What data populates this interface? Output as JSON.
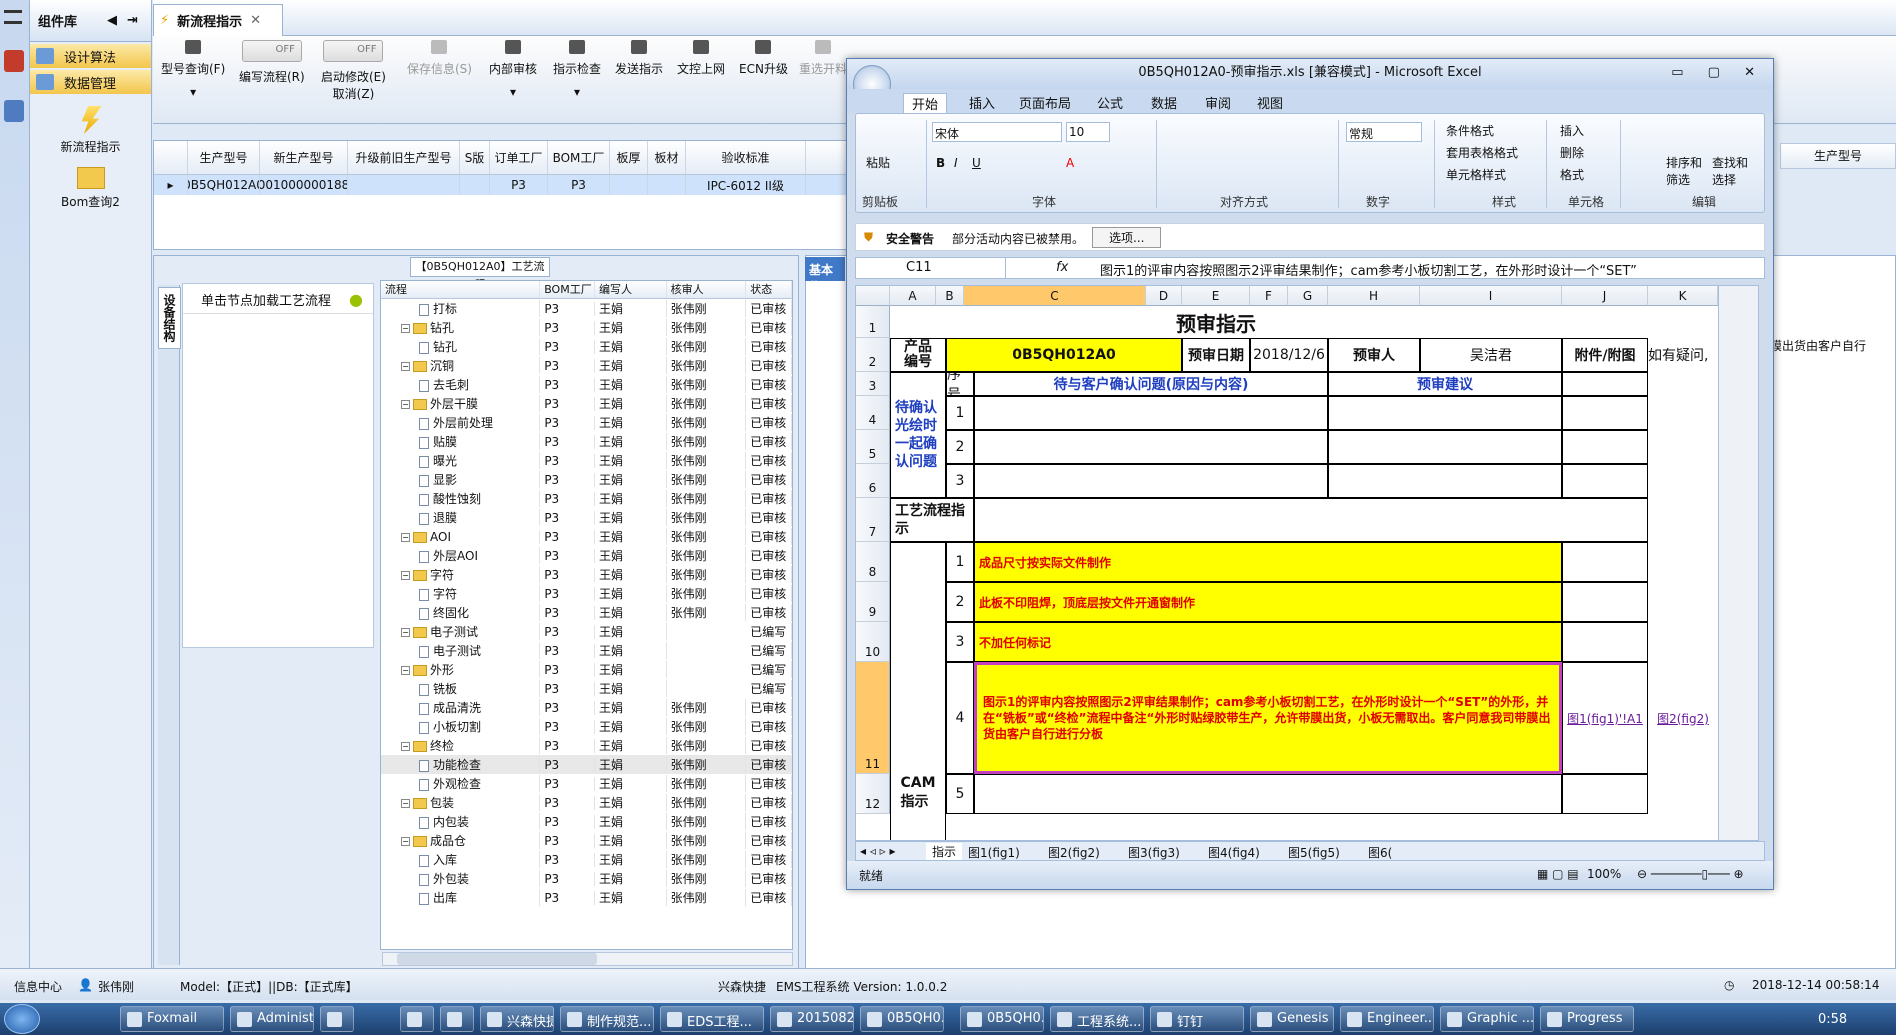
{
  "left_panel": {
    "title": "组件库",
    "items": [
      "设计算法",
      "数据管理"
    ],
    "big_items": [
      "新流程指示",
      "Bom查询2"
    ]
  },
  "main_tab": {
    "label": "新流程指示"
  },
  "toolbar": {
    "model_query": "型号查询(F)",
    "toggle_off": "OFF",
    "write_flow": "编写流程(R)",
    "start_mod": "启动修改(E)",
    "cancel": "取消(Z)",
    "save": "保存信息(S)",
    "internal_audit": "内部审核",
    "check": "指示检查",
    "send": "发送指示",
    "doc_upload": "文控上网",
    "ecn": "ECN升级",
    "reselect": "重选开料"
  },
  "grid": {
    "headers": [
      "生产型号",
      "新生产型号",
      "升级前旧生产型号",
      "S版",
      "订单工厂",
      "BOM工厂",
      "板厚",
      "板材",
      "验收标准"
    ],
    "row": [
      "0B5QH012A0",
      "10010000001886",
      "",
      "",
      "P3",
      "P3",
      "",
      "",
      "IPC-6012 II级"
    ]
  },
  "process_panel": {
    "title": "【0B5QH012A0】工艺流程",
    "side_tab": "设备结构",
    "node_hint": "单击节点加载工艺流程",
    "tree_headers": [
      "流程",
      "BOM工厂",
      "编写人",
      "核审人",
      "状态"
    ],
    "rows": [
      {
        "name": "打标",
        "lvl": 2,
        "factory": "P3",
        "writer": "王娟",
        "auditor": "张伟刚",
        "status": "已审核"
      },
      {
        "name": "钻孔",
        "lvl": 1,
        "factory": "P3",
        "writer": "王娟",
        "auditor": "张伟刚",
        "status": "已审核"
      },
      {
        "name": "钻孔",
        "lvl": 2,
        "factory": "P3",
        "writer": "王娟",
        "auditor": "张伟刚",
        "status": "已审核"
      },
      {
        "name": "沉铜",
        "lvl": 1,
        "factory": "P3",
        "writer": "王娟",
        "auditor": "张伟刚",
        "status": "已审核"
      },
      {
        "name": "去毛刺",
        "lvl": 2,
        "factory": "P3",
        "writer": "王娟",
        "auditor": "张伟刚",
        "status": "已审核"
      },
      {
        "name": "外层干膜",
        "lvl": 1,
        "factory": "P3",
        "writer": "王娟",
        "auditor": "张伟刚",
        "status": "已审核"
      },
      {
        "name": "外层前处理",
        "lvl": 2,
        "factory": "P3",
        "writer": "王娟",
        "auditor": "张伟刚",
        "status": "已审核"
      },
      {
        "name": "贴膜",
        "lvl": 2,
        "factory": "P3",
        "writer": "王娟",
        "auditor": "张伟刚",
        "status": "已审核"
      },
      {
        "name": "曝光",
        "lvl": 2,
        "factory": "P3",
        "writer": "王娟",
        "auditor": "张伟刚",
        "status": "已审核"
      },
      {
        "name": "显影",
        "lvl": 2,
        "factory": "P3",
        "writer": "王娟",
        "auditor": "张伟刚",
        "status": "已审核"
      },
      {
        "name": "酸性蚀刻",
        "lvl": 2,
        "factory": "P3",
        "writer": "王娟",
        "auditor": "张伟刚",
        "status": "已审核"
      },
      {
        "name": "退膜",
        "lvl": 2,
        "factory": "P3",
        "writer": "王娟",
        "auditor": "张伟刚",
        "status": "已审核"
      },
      {
        "name": "AOI",
        "lvl": 1,
        "factory": "P3",
        "writer": "王娟",
        "auditor": "张伟刚",
        "status": "已审核"
      },
      {
        "name": "外层AOI",
        "lvl": 2,
        "factory": "P3",
        "writer": "王娟",
        "auditor": "张伟刚",
        "status": "已审核"
      },
      {
        "name": "字符",
        "lvl": 1,
        "factory": "P3",
        "writer": "王娟",
        "auditor": "张伟刚",
        "status": "已审核"
      },
      {
        "name": "字符",
        "lvl": 2,
        "factory": "P3",
        "writer": "王娟",
        "auditor": "张伟刚",
        "status": "已审核"
      },
      {
        "name": "终固化",
        "lvl": 2,
        "factory": "P3",
        "writer": "王娟",
        "auditor": "张伟刚",
        "status": "已审核"
      },
      {
        "name": "电子测试",
        "lvl": 1,
        "factory": "P3",
        "writer": "王娟",
        "auditor": "",
        "status": "已编写"
      },
      {
        "name": "电子测试",
        "lvl": 2,
        "factory": "P3",
        "writer": "王娟",
        "auditor": "",
        "status": "已编写"
      },
      {
        "name": "外形",
        "lvl": 1,
        "factory": "P3",
        "writer": "王娟",
        "auditor": "",
        "status": "已编写"
      },
      {
        "name": "铣板",
        "lvl": 2,
        "factory": "P3",
        "writer": "王娟",
        "auditor": "",
        "status": "已编写"
      },
      {
        "name": "成品清洗",
        "lvl": 2,
        "factory": "P3",
        "writer": "王娟",
        "auditor": "张伟刚",
        "status": "已审核"
      },
      {
        "name": "小板切割",
        "lvl": 2,
        "factory": "P3",
        "writer": "王娟",
        "auditor": "张伟刚",
        "status": "已审核"
      },
      {
        "name": "终检",
        "lvl": 1,
        "factory": "P3",
        "writer": "王娟",
        "auditor": "张伟刚",
        "status": "已审核"
      },
      {
        "name": "功能检查",
        "lvl": 2,
        "factory": "P3",
        "writer": "王娟",
        "auditor": "张伟刚",
        "status": "已审核",
        "sel": true
      },
      {
        "name": "外观检查",
        "lvl": 2,
        "factory": "P3",
        "writer": "王娟",
        "auditor": "张伟刚",
        "status": "已审核"
      },
      {
        "name": "包装",
        "lvl": 1,
        "factory": "P3",
        "writer": "王娟",
        "auditor": "张伟刚",
        "status": "已审核"
      },
      {
        "name": "内包装",
        "lvl": 2,
        "factory": "P3",
        "writer": "王娟",
        "auditor": "张伟刚",
        "status": "已审核"
      },
      {
        "name": "成品仓",
        "lvl": 1,
        "factory": "P3",
        "writer": "王娟",
        "auditor": "张伟刚",
        "status": "已审核"
      },
      {
        "name": "入库",
        "lvl": 2,
        "factory": "P3",
        "writer": "王娟",
        "auditor": "张伟刚",
        "status": "已审核"
      },
      {
        "name": "外包装",
        "lvl": 2,
        "factory": "P3",
        "writer": "王娟",
        "auditor": "张伟刚",
        "status": "已审核"
      },
      {
        "name": "出库",
        "lvl": 2,
        "factory": "P3",
        "writer": "王娟",
        "auditor": "张伟刚",
        "status": "已审核"
      }
    ]
  },
  "right_panel": {
    "basic_tab": "基本信",
    "col_head": "生产型号",
    "note": "膜出货由客户自行"
  },
  "excel": {
    "title": "0B5QH012A0-预审指示.xls [兼容模式] - Microsoft Excel",
    "tabs": [
      "开始",
      "插入",
      "页面布局",
      "公式",
      "数据",
      "审阅",
      "视图"
    ],
    "ribbon": {
      "paste": "粘贴",
      "font": "宋体",
      "size": "10",
      "number_fmt": "常规",
      "cond_fmt": "条件格式",
      "table_fmt": "套用表格格式",
      "cell_style": "单元格样式",
      "insert": "插入",
      "delete": "删除",
      "format": "格式",
      "sort": "排序和\n筛选",
      "find": "查找和\n选择",
      "groups": [
        "剪贴板",
        "字体",
        "对齐方式",
        "数字",
        "样式",
        "单元格",
        "编辑"
      ]
    },
    "security": {
      "label": "安全警告",
      "text": "部分活动内容已被禁用。",
      "button": "选项..."
    },
    "name_box": "C11",
    "formula": "图示1的评审内容按照图示2评审结果制作；cam参考小板切割工艺，在外形时设计一个“SET”",
    "columns": [
      "A",
      "B",
      "C",
      "D",
      "E",
      "F",
      "G",
      "H",
      "I",
      "J",
      "K"
    ],
    "rows": [
      "1",
      "2",
      "3",
      "4",
      "5",
      "6",
      "7",
      "8",
      "9",
      "10",
      "11",
      "12"
    ],
    "cells": {
      "title": "预审指示",
      "product_no_label": "产品\n编号",
      "product_no": "0B5QH012A0",
      "review_date_label": "预审日期",
      "review_date": "2018/12/6",
      "reviewer_label": "预审人",
      "reviewer": "吴洁君",
      "attach_label": "附件/附图",
      "question_label": "如有疑问,",
      "seq_label": "序号",
      "issue_label": "待与客户确认问题(原因与内容)",
      "suggest_label": "预审建议",
      "pending_label": "待确认光绘时一起确认问题",
      "flow_label": "工艺流程指示",
      "cam_label": "CAM\n指示",
      "n1": "1",
      "n2": "2",
      "n3": "3",
      "n4": "4",
      "n5": "5",
      "i1": "成品尺寸按实际文件制作",
      "i2": "此板不印阻焊，顶底层按文件开通窗制作",
      "i3": "不加任何标记",
      "i4": "图示1的评审内容按照图示2评审结果制作；cam参考小板切割工艺，在外形时设计一个“SET”的外形，并在“铣板”或“终检”流程中备注“外形时贴绿胶带生产，允许带膜出货，小板无需取出。客户同意我司带膜出货由客户自行进行分板",
      "link1": "图1(fig1)'!A1",
      "link2": "图2(fig2)"
    },
    "sheet_tabs": [
      "指示",
      "图1(fig1)",
      "图2(fig2)",
      "图3(fig3)",
      "图4(fig4)",
      "图5(fig5)",
      "图6("
    ],
    "status_ready": "就绪",
    "zoom": "100%"
  },
  "status": {
    "info": "信息中心",
    "user": "张伟刚",
    "model": "Model:【正式】||DB:【正式库】",
    "company": "兴森快捷",
    "system": "EMS工程系统 Version: 1.0.0.2",
    "datetime": "2018-12-14 00:58:14"
  },
  "taskbar": {
    "items": [
      "Foxmail",
      "Administ...",
      "",
      "",
      "",
      "兴森快捷...",
      "制作规范...",
      "EDS工程...",
      "2015082...",
      "0B5QH0...",
      "0B5QH0...",
      "工程系统...",
      "钉钉",
      "Genesis",
      "Engineer...",
      "Graphic ...",
      "Progress"
    ],
    "clock": "0:58"
  }
}
